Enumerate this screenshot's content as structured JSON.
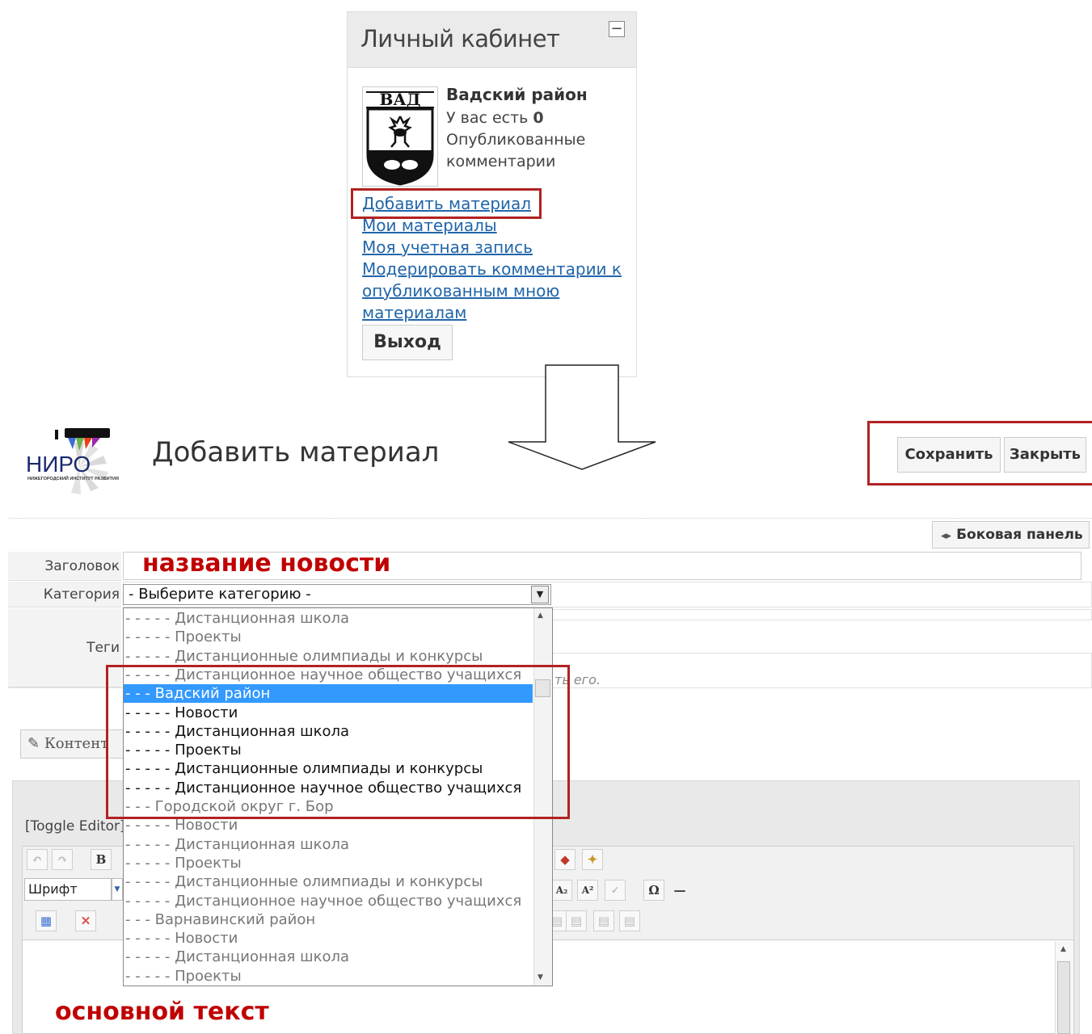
{
  "cabinet": {
    "title": "Личный кабинет",
    "collapse_label": "−",
    "user_name": "Вадский район",
    "comments_prefix": "У вас есть ",
    "comments_count": "0",
    "comments_suffix": "Опубликованные комментарии",
    "links": {
      "add_material": "Добавить материал",
      "my_materials": "Мои материалы",
      "my_account": "Моя учетная запись",
      "moderate_line1": "Модерировать комментарии к",
      "moderate_line2": "опубликованным мною",
      "moderate_line3": "материалам"
    },
    "logout": "Выход",
    "emblem_text": "ВАД"
  },
  "header": {
    "logo_text": "НИРО",
    "logo_subtext": "НИЖЕГОРОДСКИЙ ИНСТИТУТ РАЗВИТИЯ",
    "title": "Добавить материал",
    "save": "Сохранить",
    "close": "Закрыть",
    "sidebar_toggle": "Боковая панель"
  },
  "form": {
    "title_label": "Заголовок",
    "title_value": "название новости",
    "category_label": "Категория",
    "category_selected": "- Выберите категорию -",
    "tags_label": "Теги",
    "tags_hint": "ть его."
  },
  "dropdown": {
    "items": [
      {
        "text": "- - - - - Дистанционная школа",
        "style": "faded"
      },
      {
        "text": "- - - - - Проекты",
        "style": "faded"
      },
      {
        "text": "- - - - - Дистанционные олимпиады и конкурсы",
        "style": "faded"
      },
      {
        "text": "- - - - - Дистанционное научное общество учащихся",
        "style": "faded"
      },
      {
        "text": "- - - Вадский район",
        "style": "selected"
      },
      {
        "text": "- - - - - Новости",
        "style": "dark"
      },
      {
        "text": "- - - - - Дистанционная школа",
        "style": "dark"
      },
      {
        "text": "- - - - - Проекты",
        "style": "dark"
      },
      {
        "text": "- - - - - Дистанционные олимпиады и конкурсы",
        "style": "dark"
      },
      {
        "text": "- - - - - Дистанционное научное общество учащихся",
        "style": "dark"
      },
      {
        "text": "- - - Городской округ г. Бор",
        "style": "faded"
      },
      {
        "text": "- - - - - Новости",
        "style": "faded"
      },
      {
        "text": "- - - - - Дистанционная школа",
        "style": "faded"
      },
      {
        "text": "- - - - - Проекты",
        "style": "faded"
      },
      {
        "text": "- - - - - Дистанционные олимпиады и конкурсы",
        "style": "faded"
      },
      {
        "text": "- - - - - Дистанционное научное общество учащихся",
        "style": "faded"
      },
      {
        "text": "- - - Варнавинский район",
        "style": "faded"
      },
      {
        "text": "- - - - - Новости",
        "style": "faded"
      },
      {
        "text": "- - - - - Дистанционная школа",
        "style": "faded"
      },
      {
        "text": "- - - - - Проекты",
        "style": "faded"
      }
    ]
  },
  "editor": {
    "content_tab": "Контент",
    "toggle_editor": "[Toggle Editor]",
    "font_select": "Шрифт",
    "bold": "B",
    "subscript": "A₂",
    "superscript": "A²",
    "omega": "Ω",
    "hr": "—",
    "main_text": "основной текст"
  },
  "colors": {
    "annotation_red": "#c00000",
    "highlight_box": "#b22222",
    "link_blue": "#2266aa",
    "selection_blue": "#3399ff"
  }
}
